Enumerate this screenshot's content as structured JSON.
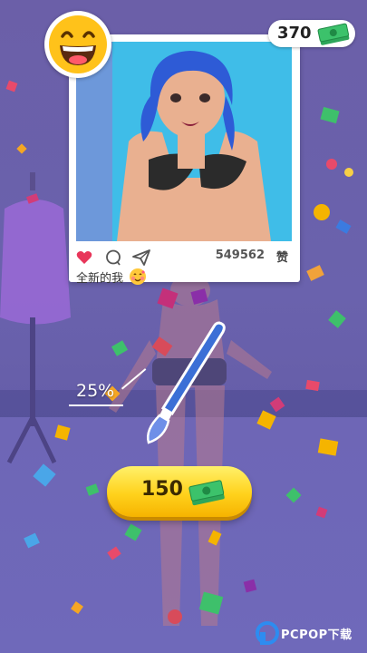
{
  "post": {
    "likes": "549562",
    "like_word": "赞",
    "caption": "全新的我"
  },
  "currency": {
    "balance": "370"
  },
  "progress": {
    "label": "25%",
    "value": 0.25
  },
  "reward": {
    "amount": "150"
  },
  "watermark": {
    "text": "PCPOP下载"
  },
  "colors": {
    "accent_gold": "#ffd21c",
    "cash_green": "#3cc26b",
    "heart": "#e8365a",
    "photo_bg": "#3fbde8"
  }
}
